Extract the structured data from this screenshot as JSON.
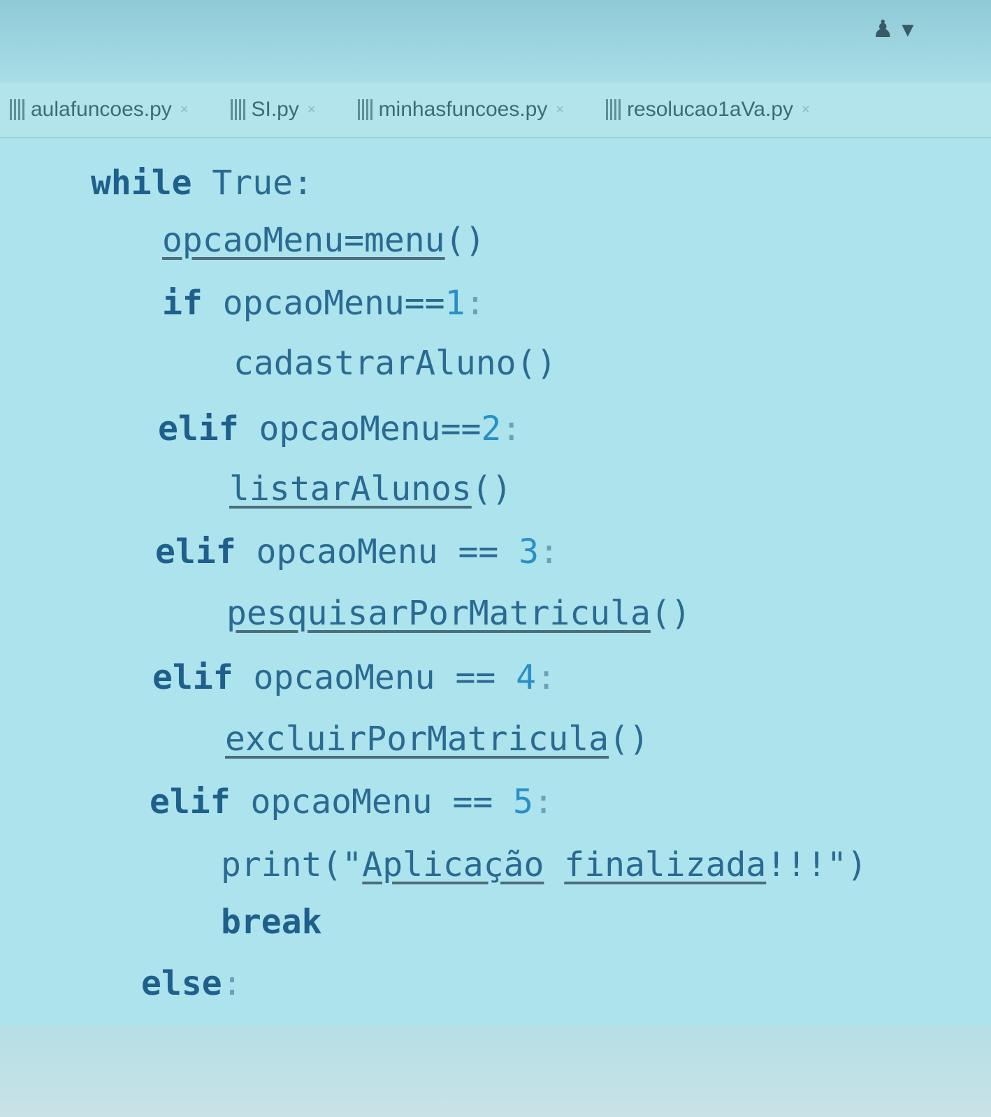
{
  "header": {
    "user_indicator": "♟ ▾"
  },
  "tabs": [
    {
      "label": "aulafuncoes.py",
      "icon": "python-file-icon"
    },
    {
      "label": "SI.py",
      "icon": "python-file-icon"
    },
    {
      "label": "minhasfuncoes.py",
      "icon": "python-file-icon"
    },
    {
      "label": "resolucao1aVa.py",
      "icon": "python-file-icon"
    }
  ],
  "tab_close": "×",
  "code": {
    "l1": {
      "kw": "while",
      "rest": " True:"
    },
    "l2": {
      "a": "opcaoMenu=",
      "b": "menu",
      "c": "()"
    },
    "l3": {
      "kw": "if",
      "a": " opcaoMenu==",
      "num": "1",
      "c": ":"
    },
    "l4": {
      "a": "cadastrarAluno()"
    },
    "l5": {
      "kw": "elif",
      "a": " opcaoMenu==",
      "num": "2",
      "c": ":"
    },
    "l6": {
      "b": "listarAlunos",
      "c": "()"
    },
    "l7": {
      "kw": "elif",
      "a": " opcaoMenu == ",
      "num": "3",
      "c": ":"
    },
    "l8": {
      "b": "pesquisarPorMatricula",
      "c": "()"
    },
    "l9": {
      "kw": "elif",
      "a": " opcaoMenu == ",
      "num": "4",
      "c": ":"
    },
    "l10": {
      "b": "excluirPorMatricula",
      "c": "()"
    },
    "l11": {
      "kw": "elif",
      "a": " opcaoMenu == ",
      "num": "5",
      "c": ":"
    },
    "l12": {
      "a": "print(\"",
      "b1": "Aplicação",
      "sp": " ",
      "b2": "finalizada",
      "c": "!!!\")"
    },
    "l13": {
      "kw": "break"
    },
    "l14": {
      "kw": "else",
      "c": ":"
    }
  }
}
